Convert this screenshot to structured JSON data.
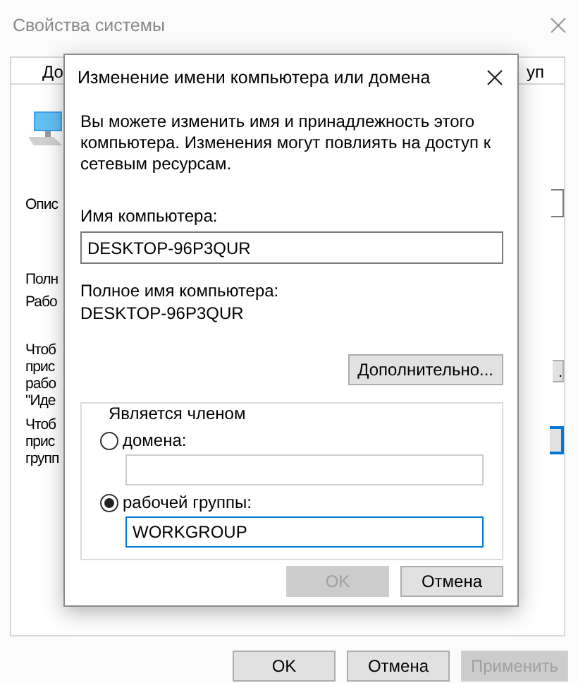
{
  "window": {
    "title": "Свойства системы"
  },
  "tabs": [
    {
      "label": "До",
      "selected": true
    },
    {
      "label": "уп",
      "selected": false
    }
  ],
  "panel": {
    "description_label": "Опис",
    "full_name_label": "Полн",
    "workgroup_label": "Рабо",
    "paragraphs": [
      [
        "Чтоб",
        "прис",
        "рабо",
        "\"Иде"
      ],
      [
        "Чтоб",
        "прис",
        "групп"
      ]
    ],
    "side_button": "."
  },
  "buttons": [
    {
      "label": "OK",
      "disabled": false
    },
    {
      "label": "Отмена",
      "disabled": false
    },
    {
      "label": "Применить",
      "disabled": true
    }
  ],
  "dialog": {
    "title": "Изменение имени компьютера или домена",
    "description": "Вы можете изменить имя и принадлежность этого компьютера. Изменения могут повлиять на доступ к сетевым ресурсам.",
    "computer_name": {
      "label": "Имя компьютера:",
      "value": "DESKTOP-96P3QUR"
    },
    "full_name": {
      "label": "Полное имя компьютера:",
      "value": "DESKTOP-96P3QUR"
    },
    "more_button": "Дополнительно...",
    "membership": {
      "legend": "Является членом",
      "options": [
        {
          "label": "домена:",
          "selected": false
        },
        {
          "label": "рабочей группы:",
          "selected": true,
          "value": "WORKGROUP"
        }
      ]
    },
    "buttons": [
      {
        "label": "OK",
        "disabled": true
      },
      {
        "label": "Отмена",
        "disabled": false
      }
    ]
  }
}
